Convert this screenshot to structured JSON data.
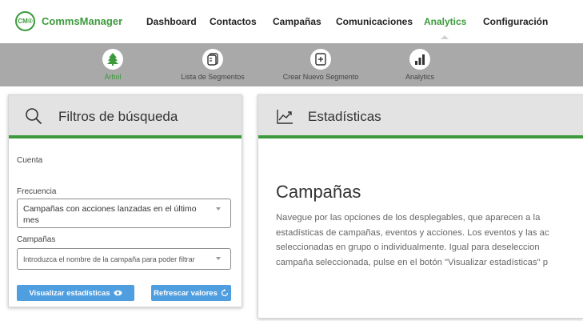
{
  "app": {
    "logo_text": "CM®",
    "name": "CommsManager"
  },
  "nav": {
    "items": [
      {
        "label": "Dashboard",
        "active": false
      },
      {
        "label": "Contactos",
        "active": false
      },
      {
        "label": "Campañas",
        "active": false
      },
      {
        "label": "Comunicaciones",
        "active": false
      },
      {
        "label": "Analytics",
        "active": true
      },
      {
        "label": "Configuración",
        "active": false
      }
    ]
  },
  "subnav": {
    "items": [
      {
        "label": "Árbol",
        "icon": "tree-icon",
        "active": true
      },
      {
        "label": "Lista de Segmentos",
        "icon": "document-list-icon",
        "active": false
      },
      {
        "label": "Crear Nuevo Segmento",
        "icon": "new-document-icon",
        "active": false
      },
      {
        "label": "Analytics",
        "icon": "bar-chart-icon",
        "active": false
      }
    ]
  },
  "filters": {
    "title": "Filtros de búsqueda",
    "account_label": "Cuenta",
    "frequency_label": "Frecuencia",
    "frequency_value_line1": "Campañas con acciones lanzadas en el último",
    "frequency_value_line2": "mes",
    "campaigns_label": "Campañas",
    "campaigns_placeholder": "Introduzca el nombre de la campaña para poder filtrar",
    "view_button": "Visualizar estadísticas",
    "refresh_button": "Refrescar valores"
  },
  "stats": {
    "title": "Estadísticas",
    "heading": "Campañas",
    "paragraph_lines": [
      "Navegue por las opciones de los desplegables, que aparecen a la",
      "estadísticas de campañas, eventos y acciones. Los eventos y las ac",
      "seleccionadas en grupo o individualmente. Igual para deseleccion",
      "campaña seleccionada, pulse en el botón \"Visualizar estadísticas\" p"
    ]
  },
  "colors": {
    "accent": "#3c9a3c",
    "button": "#4f9ee0",
    "subbar": "#a9a9a9",
    "panel_header": "#e3e3e3"
  }
}
